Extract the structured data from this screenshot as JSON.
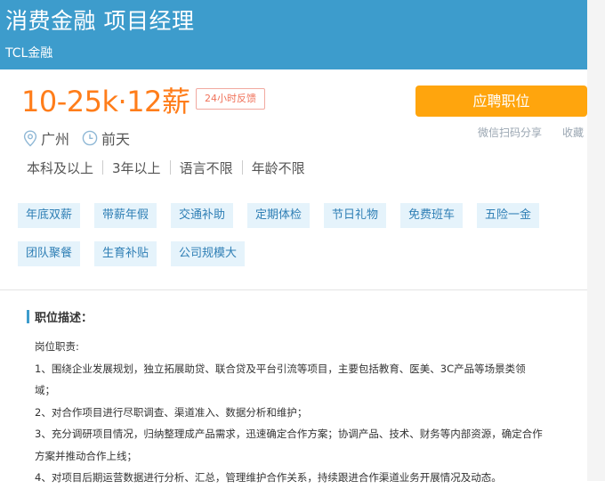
{
  "header": {
    "job_title": "消费金融 项目经理",
    "company": "TCL金融"
  },
  "salary": "10-25k·12薪",
  "feedback_badge": "24小时反馈",
  "apply_button": "应聘职位",
  "share_link": "微信扫码分享",
  "collect_link": "收藏",
  "location": "广州",
  "posted": "前天",
  "requirements": [
    "本科及以上",
    "3年以上",
    "语言不限",
    "年龄不限"
  ],
  "benefits": [
    "年底双薪",
    "带薪年假",
    "交通补助",
    "定期体检",
    "节日礼物",
    "免费班车",
    "五险一金",
    "团队聚餐",
    "生育补贴",
    "公司规模大"
  ],
  "description": {
    "title": "职位描述：",
    "lines": [
      "岗位职责:",
      "1、围绕企业发展规划，独立拓展助贷、联合贷及平台引流等项目，主要包括教育、医美、3C产品等场景类领",
      "域；",
      "2、对合作项目进行尽职调查、渠道准入、数据分析和维护；",
      "3、充分调研项目情况，归纳整理成产品需求，迅速确定合作方案；协调产品、技术、财务等内部资源，确定合作",
      "方案并推动合作上线；",
      "4、对项目后期运营数据进行分析、汇总，管理维护合作关系，持续跟进合作渠道业务开展情况及动态。"
    ]
  },
  "colors": {
    "header_bg": "#3d9ccc",
    "salary": "#ff7d1a",
    "apply_button": "#ffa50d",
    "tag_bg": "#e5f3fb",
    "tag_text": "#2f7fb5"
  },
  "icons": {
    "location": "location-pin-icon",
    "time": "clock-icon"
  }
}
